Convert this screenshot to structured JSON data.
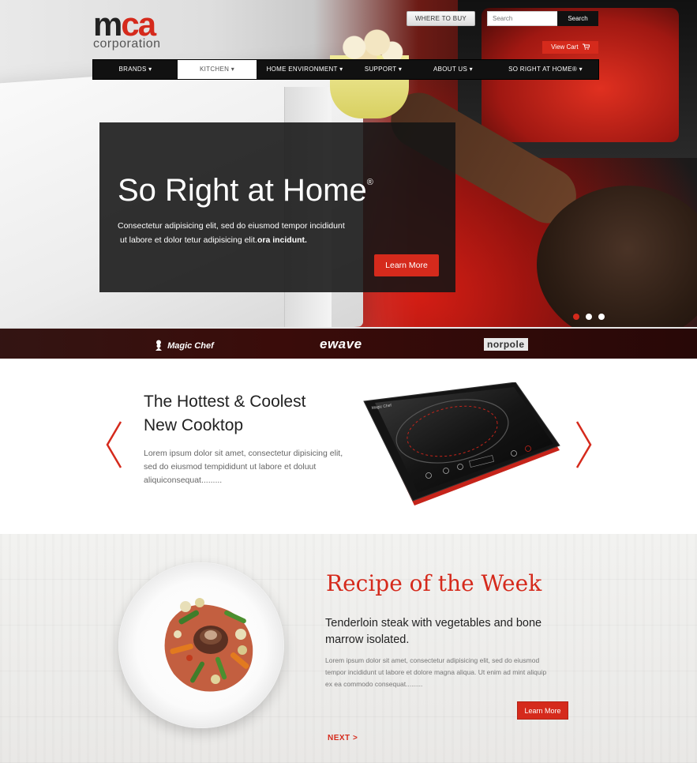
{
  "header": {
    "logo_mark_m": "m",
    "logo_mark_c": "c",
    "logo_mark_a": "a",
    "logo_sub": "corporation",
    "where_to_buy": "WHERE TO BUY",
    "search_placeholder": "Search",
    "search_button": "Search",
    "view_cart": "View Cart"
  },
  "nav": {
    "items": [
      {
        "label": "BRANDS ▾"
      },
      {
        "label": "KITCHEN ▾"
      },
      {
        "label": "HOME ENVIRONMENT ▾"
      },
      {
        "label": "SUPPORT ▾"
      },
      {
        "label": "ABOUT US ▾"
      },
      {
        "label": "SO RIGHT AT HOME® ▾"
      }
    ],
    "active_index": 1
  },
  "hero": {
    "title": "So Right at Home",
    "title_mark": "®",
    "text_line1": "Consectetur adipisicing elit, sed do eiusmod tempor incididunt",
    "text_line2": "ut labore et dolor tetur adipisicing elit.",
    "text_line2_bold": "ora incidunt.",
    "button": "Learn More",
    "slides": 3,
    "active_slide": 0
  },
  "brands": {
    "magic_chef": "Magic Chef",
    "ewave": "ewave",
    "norpole": "norpole"
  },
  "product": {
    "title_line1": "The Hottest & Coolest",
    "title_line2": "New Cooktop",
    "text": "Lorem ipsum dolor sit amet, consectetur dipisicing elit, sed do eiusmod tempididunt ut labore et doluut aliquiconsequat.........",
    "cooktop_brand": "Magic Chef"
  },
  "recipe": {
    "title": "Recipe of the Week",
    "subtitle": "Tenderloin steak with vegetables and bone marrow isolated.",
    "text": "Lorem ipsum dolor sit amet, consectetur adipisicing elit, sed do eiusmod tempor incididunt ut labore et dolore magna aliqua. Ut enim ad mint aliquip ex ea commodo consequat.........",
    "button": "Learn More",
    "next": "NEXT >"
  },
  "colors": {
    "accent": "#d52a1c",
    "nav_bg": "#111111",
    "hero_card": "#141414"
  }
}
